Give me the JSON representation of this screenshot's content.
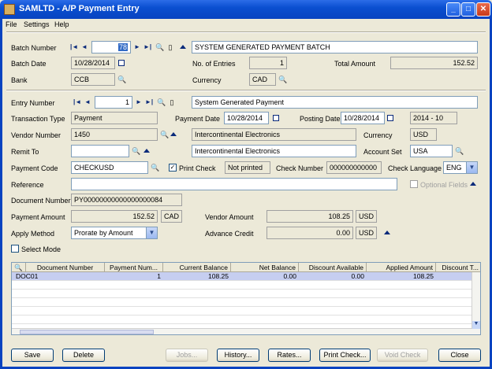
{
  "window": {
    "title": "SAMLTD - A/P Payment Entry",
    "min_glyph": "_",
    "max_glyph": "□",
    "close_glyph": "✕"
  },
  "menu": [
    "File",
    "Settings",
    "Help"
  ],
  "batch": {
    "number_label": "Batch Number",
    "number": "78",
    "description": "SYSTEM GENERATED PAYMENT BATCH",
    "date_label": "Batch Date",
    "date": "10/28/2014",
    "entries_label": "No. of Entries",
    "entries": "1",
    "total_label": "Total Amount",
    "total": "152.52",
    "bank_label": "Bank",
    "bank": "CCB",
    "currency_label": "Currency",
    "currency": "CAD"
  },
  "entry": {
    "number_label": "Entry Number",
    "number": "1",
    "description": "System Generated Payment",
    "type_label": "Transaction Type",
    "type": "Payment",
    "payment_date_label": "Payment Date",
    "payment_date": "10/28/2014",
    "posting_date_label": "Posting Date",
    "posting_date": "10/28/2014",
    "period": "2014 - 10",
    "vendor_label": "Vendor Number",
    "vendor": "1450",
    "vendor_name": "Intercontinental Electronics",
    "vendor_currency_label": "Currency",
    "vendor_currency": "USD",
    "remit_label": "Remit To",
    "remit": "",
    "remit_name": "Intercontinental Electronics",
    "account_set_label": "Account Set",
    "account_set": "USA",
    "payment_code_label": "Payment Code",
    "payment_code": "CHECKUSD",
    "print_check_label": "Print Check",
    "check_status": "Not printed",
    "check_number_label": "Check Number",
    "check_number": "000000000000",
    "check_language_label": "Check Language",
    "check_language": "ENG",
    "reference_label": "Reference",
    "reference": "",
    "optional_fields_label": "Optional Fields",
    "document_number_label": "Document Number",
    "document_number": "PY00000000000000000084",
    "payment_amount_label": "Payment Amount",
    "payment_amount": "152.52",
    "payment_amount_currency": "CAD",
    "vendor_amount_label": "Vendor Amount",
    "vendor_amount": "108.25",
    "vendor_amount_currency": "USD",
    "apply_method_label": "Apply Method",
    "apply_method": "Prorate by Amount",
    "advance_credit_label": "Advance Credit",
    "advance_credit": "0.00",
    "advance_credit_currency": "USD",
    "select_mode_label": "Select Mode"
  },
  "grid": {
    "columns": [
      "Document Number",
      "Payment Num...",
      "Current Balance",
      "Net Balance",
      "Discount Available",
      "Applied Amount",
      "Discount T..."
    ],
    "rows": [
      [
        "DOC01",
        "1",
        "108.25",
        "0.00",
        "0.00",
        "108.25",
        ""
      ]
    ]
  },
  "buttons": {
    "save": "Save",
    "delete": "Delete",
    "jobs": "Jobs...",
    "history": "History...",
    "rates": "Rates...",
    "print_check": "Print Check...",
    "void_check": "Void Check",
    "close": "Close"
  },
  "icons": {
    "first": "|◄",
    "prev": "◄",
    "next": "►",
    "last": "►|",
    "finder": "🔍",
    "new_doc": "▯",
    "dropdown": "▼",
    "checkmark": "✓"
  }
}
